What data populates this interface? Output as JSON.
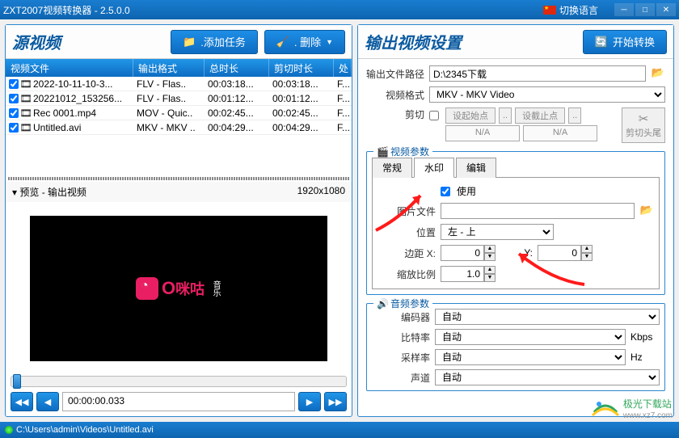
{
  "titlebar": {
    "title": "ZXT2007视频转换器 - 2.5.0.0",
    "lang_label": "切换语言"
  },
  "left": {
    "title": "源视频",
    "add_task": ".添加任务",
    "delete": ". 删除",
    "columns": [
      "视频文件",
      "输出格式",
      "总时长",
      "剪切时长",
      "处"
    ],
    "rows": [
      {
        "file": "2022-10-11-10-3...",
        "fmt": "FLV - Flas..",
        "total": "00:03:18...",
        "cut": "00:03:18...",
        "p": "F..."
      },
      {
        "file": "20221012_153256...",
        "fmt": "FLV - Flas..",
        "total": "00:01:12...",
        "cut": "00:01:12...",
        "p": "F..."
      },
      {
        "file": "Rec 0001.mp4",
        "fmt": "MOV - Quic..",
        "total": "00:02:45...",
        "cut": "00:02:45...",
        "p": "F..."
      },
      {
        "file": "Untitled.avi",
        "fmt": "MKV - MKV ..",
        "total": "00:04:29...",
        "cut": "00:04:29...",
        "p": "F..."
      }
    ],
    "preview_label": "▾ 预览 - 输出视频",
    "preview_res": "1920x1080",
    "video_logo_text": "咪咕",
    "video_logo_cn": "音乐",
    "time": "00:00:00.033"
  },
  "right": {
    "title": "输出视频设置",
    "start": "开始转换",
    "path_label": "输出文件路径",
    "path_value": "D:\\2345下载",
    "fmt_label": "视频格式",
    "fmt_value": "MKV - MKV Video",
    "cut_label": "剪切",
    "cut_start": "设起始点",
    "cut_end": "设截止点",
    "na": "N/A",
    "cut_btn": "剪切头尾",
    "video_params": "视频参数",
    "tabs": [
      "常规",
      "水印",
      "编辑"
    ],
    "use_label": "使用",
    "pic_label": "图片文件",
    "pos_label": "位置",
    "pos_value": "左 - 上",
    "margin_label": "边距 X:",
    "margin_x": "0",
    "margin_y_label": "Y:",
    "margin_y": "0",
    "scale_label": "缩放比例",
    "scale_value": "1.0",
    "audio_params": "音频参数",
    "enc_label": "编码器",
    "enc_value": "自动",
    "br_label": "比特率",
    "br_value": "自动",
    "br_unit": "Kbps",
    "sr_label": "采样率",
    "sr_value": "自动",
    "sr_unit": "Hz",
    "ch_label": "声道",
    "ch_value": "自动"
  },
  "statusbar": {
    "path": "C:\\Users\\admin\\Videos\\Untitled.avi"
  },
  "watermark": {
    "name": "极光下载站",
    "url": "www.xz7.com"
  }
}
